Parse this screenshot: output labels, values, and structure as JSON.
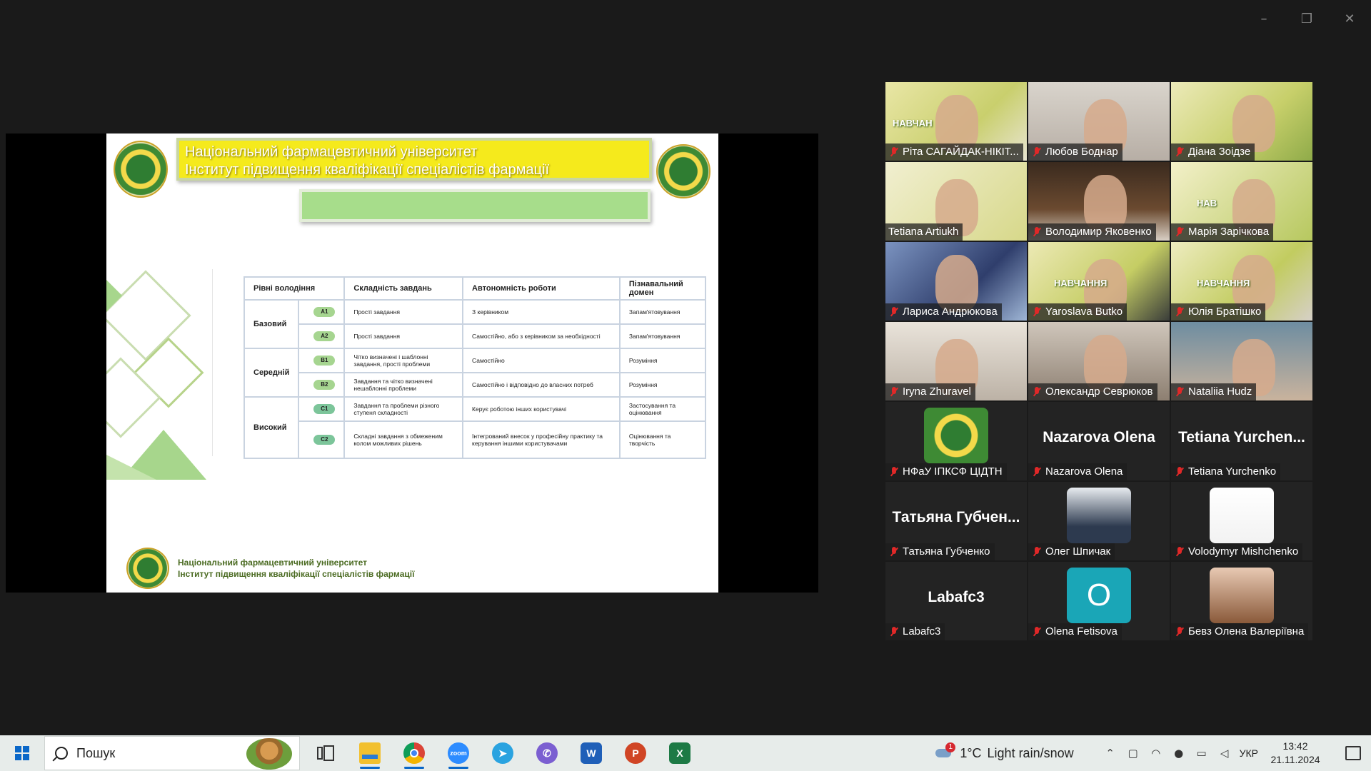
{
  "window": {
    "minimize": "–",
    "restore": "❐",
    "close": "✕"
  },
  "slide": {
    "title_line1": "Національний фармацевтичний університет",
    "title_line2": "Інститут підвищення кваліфікації спеціалістів фармації",
    "table": {
      "headers": [
        "Рівні володіння",
        "Складність завдань",
        "Автономність роботи",
        "Пізнавальний домен"
      ],
      "levels": [
        "Базовий",
        "Середній",
        "Високий"
      ],
      "rows": [
        {
          "code": "A1",
          "complexity": "Прості завдання",
          "autonomy": "З керівником",
          "domain": "Запам'ятовування"
        },
        {
          "code": "A2",
          "complexity": "Прості завдання",
          "autonomy": "Самостійно, або з керівником за необхідності",
          "domain": "Запам'ятовування"
        },
        {
          "code": "B1",
          "complexity": "Чітко визначені і шаблонні завдання, прості проблеми",
          "autonomy": "Самостійно",
          "domain": "Розуміння"
        },
        {
          "code": "B2",
          "complexity": "Завдання та чітко визначені нешаблонні проблеми",
          "autonomy": "Самостійно і відповідно до власних потреб",
          "domain": "Розуміння"
        },
        {
          "code": "C1",
          "complexity": "Завдання та проблеми різного ступеня складності",
          "autonomy": "Керує роботою інших користувачі",
          "domain": "Застосування та оцінювання"
        },
        {
          "code": "C2",
          "complexity": "Складні завдання з обмеженим колом можливих рішень",
          "autonomy": "Інтегрований внесок у професійну практику та керування іншими користувачами",
          "domain": "Оцінювання та творчість"
        }
      ]
    },
    "footer_line1": "Національний фармацевтичний університет",
    "footer_line2": "Інститут підвищення кваліфікації спеціалістів фармації"
  },
  "participants": [
    {
      "name": "Ріта САГАЙДАК-НІКІТ...",
      "muted": true,
      "type": "video",
      "banner": "НАВЧАН"
    },
    {
      "name": "Любов Боднар",
      "muted": true,
      "type": "video"
    },
    {
      "name": "Діана Зоідзе",
      "muted": true,
      "type": "video"
    },
    {
      "name": "Tetiana Artiukh",
      "muted": false,
      "type": "video",
      "active": true
    },
    {
      "name": "Володимир Яковенко",
      "muted": true,
      "type": "video"
    },
    {
      "name": "Марія Зарічкова",
      "muted": true,
      "type": "video",
      "banner": "НАВ"
    },
    {
      "name": "Лариса Андрюкова",
      "muted": true,
      "type": "video"
    },
    {
      "name": "Yaroslava Butko",
      "muted": true,
      "type": "video",
      "banner": "НАВЧАННЯ"
    },
    {
      "name": "Юлія Братішко",
      "muted": true,
      "type": "video",
      "banner": "НАВЧАННЯ"
    },
    {
      "name": "Iryna Zhuravel",
      "muted": true,
      "type": "video"
    },
    {
      "name": "Олександр Севрюков",
      "muted": true,
      "type": "video"
    },
    {
      "name": "Nataliia Hudz",
      "muted": true,
      "type": "video"
    },
    {
      "name": "НФаУ ІПКСФ ЦІДТН",
      "muted": true,
      "type": "avatar"
    },
    {
      "name": "Nazarova Olena",
      "muted": true,
      "type": "text",
      "big": "Nazarova Olena"
    },
    {
      "name": "Tetiana Yurchenko",
      "muted": true,
      "type": "text",
      "big": "Tetiana  Yurchen..."
    },
    {
      "name": "Татьяна Губченко",
      "muted": true,
      "type": "text",
      "big": "Татьяна  Губчен..."
    },
    {
      "name": "Олег Шпичак",
      "muted": true,
      "type": "avatar"
    },
    {
      "name": "Volodymyr Mishchenko",
      "muted": true,
      "type": "avatar"
    },
    {
      "name": "Labafc3",
      "muted": true,
      "type": "text",
      "big": "Labafc3"
    },
    {
      "name": "Olena Fetisova",
      "muted": true,
      "type": "letter",
      "big": "O"
    },
    {
      "name": "Бевз Олена Валеріївна",
      "muted": true,
      "type": "avatar"
    }
  ],
  "taskbar": {
    "search_placeholder": "Пошук",
    "apps": [
      "task-view",
      "file-explorer",
      "chrome",
      "zoom",
      "telegram",
      "viber",
      "word",
      "powerpoint",
      "excel"
    ],
    "weather_temp": "1°C",
    "weather_desc": "Light rain/snow",
    "weather_badge": "1",
    "language": "УКР",
    "time": "13:42",
    "date": "21.11.2024"
  },
  "colors": {
    "active_speaker": "#23d18b",
    "muted_mic": "#e02828",
    "slide_title_bg": "#f5ea1c",
    "slide_green": "#a7dd8b"
  }
}
